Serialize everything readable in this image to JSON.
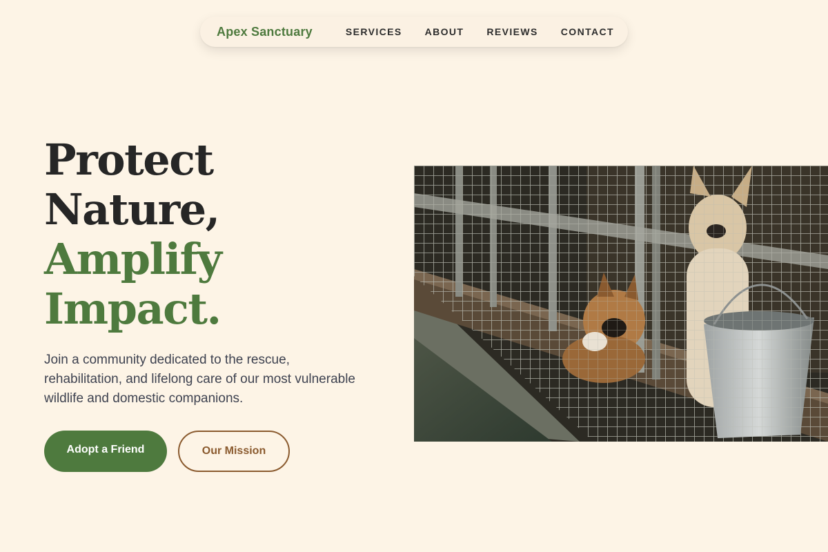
{
  "brand": {
    "name": "Apex Sanctuary"
  },
  "nav": {
    "links": [
      {
        "label": "SERVICES"
      },
      {
        "label": "ABOUT"
      },
      {
        "label": "REVIEWS"
      },
      {
        "label": "CONTACT"
      }
    ]
  },
  "hero": {
    "title_line1": "Protect",
    "title_line2": "Nature,",
    "title_line3": "Amplify",
    "title_line4": "Impact.",
    "description": "Join a community dedicated to the rescue, rehabilitation, and lifelong care of our most vulnerable wildlife and domestic companions.",
    "primary_button": "Adopt a Friend",
    "secondary_button": "Our Mission"
  },
  "colors": {
    "background": "#fdf4e6",
    "accent_green": "#4e7a3e",
    "accent_brown": "#8a5a2e",
    "heading_dark": "#262626"
  },
  "image": {
    "subject": "dogs in wire kennel cages with a metal bucket"
  }
}
